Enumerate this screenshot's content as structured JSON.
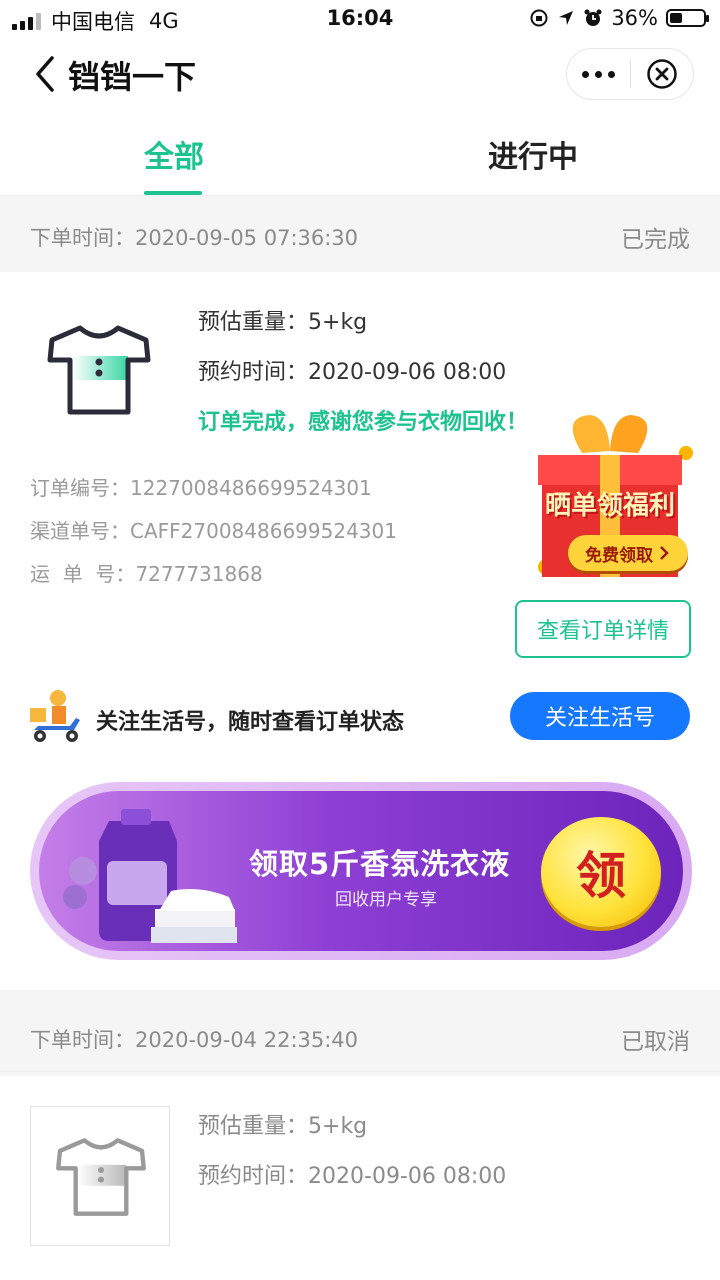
{
  "status_bar": {
    "carrier": "中国电信",
    "network": "4G",
    "time": "16:04",
    "battery": "36%",
    "battery_level": 0.36
  },
  "nav": {
    "title": "铛铛一下"
  },
  "tabs": [
    {
      "label": "全部",
      "active": true
    },
    {
      "label": "进行中",
      "active": false
    }
  ],
  "orders": [
    {
      "time_label": "下单时间：",
      "time": "2020-09-05 07:36:30",
      "status": "已完成",
      "weight_label": "预估重量：",
      "weight": "5+kg",
      "appt_label": "预约时间：",
      "appt": "2020-09-06 08:00",
      "message": "订单完成，感谢您参与衣物回收！",
      "order_no_label": "订单编号：",
      "order_no": "1227008486699524301",
      "channel_no_label": "渠道单号：",
      "channel_no": "CAFF27008486699524301",
      "waybill_label": "运  单  号：",
      "waybill": "7277731868",
      "gift_title": "晒单领福利",
      "gift_button": "免费领取",
      "detail_button": "查看订单详情",
      "follow_text": "关注生活号，随时查看订单状态",
      "follow_button": "关注生活号",
      "banner_title": "领取5斤香氛洗衣液",
      "banner_sub": "回收用户专享",
      "banner_badge": "领"
    },
    {
      "time_label": "下单时间：",
      "time": "2020-09-04 22:35:40",
      "status": "已取消",
      "weight_label": "预估重量：",
      "weight": "5+kg",
      "appt_label": "预约时间：",
      "appt": "2020-09-06 08:00"
    }
  ],
  "colors": {
    "accent": "#1dc38f",
    "follow_blue": "#1677ff",
    "banner_purple": "#8e3fd4"
  }
}
